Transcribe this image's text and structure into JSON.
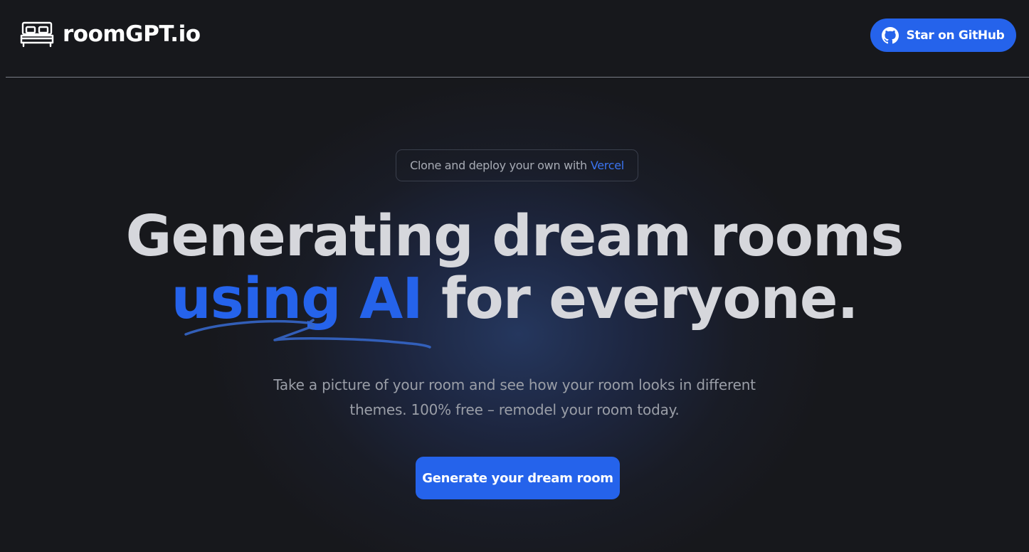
{
  "header": {
    "brand_name": "roomGPT.io",
    "brand_icon": "bed-icon",
    "github_button_label": "Star on GitHub",
    "github_icon": "github-icon"
  },
  "hero": {
    "announcement_prefix": "Clone and deploy your own with",
    "announcement_link": "Vercel",
    "headline_line1": "Generating dream rooms",
    "headline_accent": "using AI",
    "headline_rest": " for everyone.",
    "subtitle": "Take a picture of your room and see how your room looks in different themes. 100% free – remodel your room today.",
    "cta_label": "Generate your dream room"
  },
  "colors": {
    "background": "#17181c",
    "accent": "#2563eb",
    "headline_text": "#d6d7dc",
    "subtitle_text": "#9a9ea7"
  }
}
